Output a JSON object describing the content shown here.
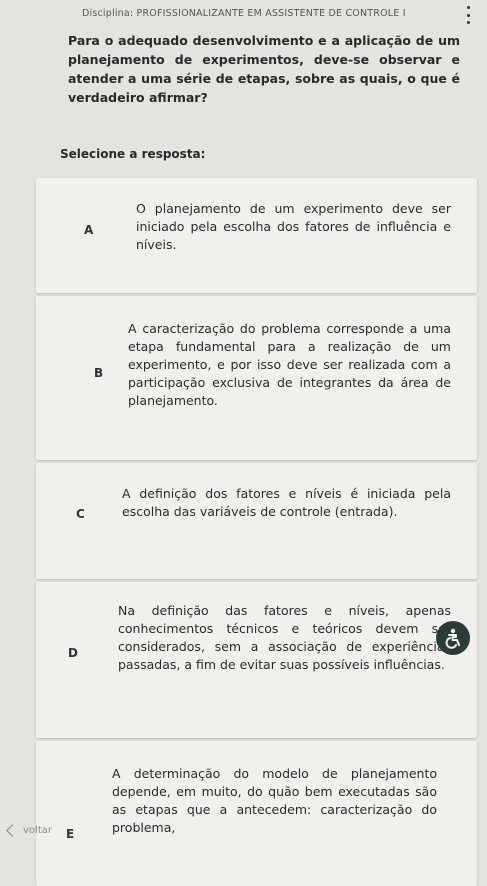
{
  "header": {
    "discipline": "Disciplina: PROFISSIONALIZANTE EM ASSISTENTE DE CONTROLE I"
  },
  "question": {
    "text": "Para o adequado desenvolvimento e a aplicação de um planejamento de experimentos, deve-se observar e atender a uma série de etapas, sobre as quais, o que é verdadeiro afirmar?"
  },
  "select_label": "Selecione a resposta:",
  "options": [
    {
      "letter": "A",
      "text": "O planejamento de um experimento deve ser iniciado pela escolha dos fatores de influência e níveis."
    },
    {
      "letter": "B",
      "text": "A caracterização do problema corresponde a uma etapa fundamental para a realização de um experimento, e por isso deve ser realizada com a participação exclusiva de integrantes da área de planejamento."
    },
    {
      "letter": "C",
      "text": "A definição dos fatores e níveis é iniciada pela escolha das variáveis de controle (entrada)."
    },
    {
      "letter": "D",
      "text": "Na definição das fatores e níveis, apenas conhecimentos técnicos e teóricos devem ser considerados, sem a associação de experiências passadas, a fim de evitar suas possíveis influências."
    },
    {
      "letter": "E",
      "text": "A determinação do modelo de planejamento depende, em muito, do quão bem executadas são as etapas que a antecedem: caracterização do problema,"
    }
  ],
  "nav": {
    "back_label": "voltar"
  },
  "accessibility": {
    "icon": "accessibility-icon"
  }
}
